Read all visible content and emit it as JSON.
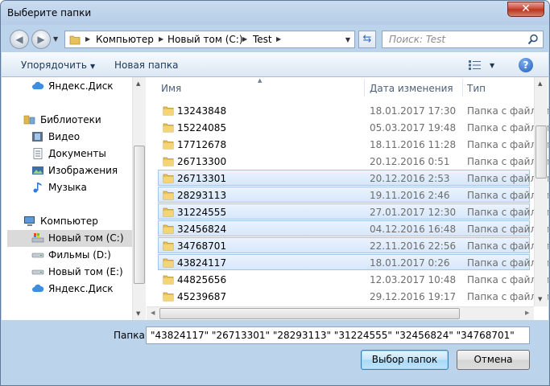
{
  "window": {
    "title": "Выберите папки",
    "close_label": "✕"
  },
  "nav": {
    "breadcrumbs": [
      "Компьютер",
      "Новый том (C:)",
      "Test"
    ],
    "search_placeholder": "Поиск: Test"
  },
  "toolbar": {
    "organize_label": "Упорядочить",
    "new_folder_label": "Новая папка",
    "help_label": "?"
  },
  "sidebar": {
    "items": [
      {
        "label": "Яндекс.Диск",
        "icon": "cloud-icon"
      },
      {
        "label": "Библиотеки",
        "icon": "libraries-icon"
      },
      {
        "label": "Видео",
        "icon": "video-icon"
      },
      {
        "label": "Документы",
        "icon": "documents-icon"
      },
      {
        "label": "Изображения",
        "icon": "pictures-icon"
      },
      {
        "label": "Музыка",
        "icon": "music-icon"
      },
      {
        "label": "Компьютер",
        "icon": "computer-icon"
      },
      {
        "label": "Новый том (C:)",
        "icon": "drive-c-icon",
        "selected": true
      },
      {
        "label": "Фильмы (D:)",
        "icon": "drive-icon"
      },
      {
        "label": "Новый том (E:)",
        "icon": "drive-icon"
      },
      {
        "label": "Яндекс.Диск",
        "icon": "cloud-icon"
      }
    ]
  },
  "columns": {
    "name": "Имя",
    "date": "Дата изменения",
    "type": "Тип"
  },
  "files": [
    {
      "name": "13243848",
      "date": "18.01.2017 17:30",
      "type": "Папка с файлами",
      "selected": false
    },
    {
      "name": "15224085",
      "date": "05.03.2017 19:48",
      "type": "Папка с файлами",
      "selected": false
    },
    {
      "name": "17712678",
      "date": "18.11.2016 11:28",
      "type": "Папка с файлами",
      "selected": false
    },
    {
      "name": "26713300",
      "date": "20.12.2016 0:51",
      "type": "Папка с файлами",
      "selected": false
    },
    {
      "name": "26713301",
      "date": "20.12.2016 2:53",
      "type": "Папка с файлами",
      "selected": true
    },
    {
      "name": "28293113",
      "date": "19.11.2016 2:46",
      "type": "Папка с файлами",
      "selected": true
    },
    {
      "name": "31224555",
      "date": "27.01.2017 12:30",
      "type": "Папка с файлами",
      "selected": true
    },
    {
      "name": "32456824",
      "date": "04.12.2016 16:48",
      "type": "Папка с файлами",
      "selected": true
    },
    {
      "name": "34768701",
      "date": "22.11.2016 22:56",
      "type": "Папка с файлами",
      "selected": true
    },
    {
      "name": "43824117",
      "date": "18.01.2017 0:26",
      "type": "Папка с файлами",
      "selected": true
    },
    {
      "name": "44825656",
      "date": "12.03.2017 10:48",
      "type": "Папка с файлами",
      "selected": false
    },
    {
      "name": "45239687",
      "date": "29.12.2016 19:17",
      "type": "Папка с файлами",
      "selected": false
    }
  ],
  "footer": {
    "folder_label": "Папка:",
    "folder_value": "\"43824117\" \"26713301\" \"28293113\" \"31224555\" \"32456824\" \"34768701\"",
    "select_button": "Выбор папок",
    "cancel_button": "Отмена"
  },
  "colors": {
    "folder": "#e8c15a",
    "selection": "#cce4f7",
    "title_bg": "#bcd3ec"
  }
}
